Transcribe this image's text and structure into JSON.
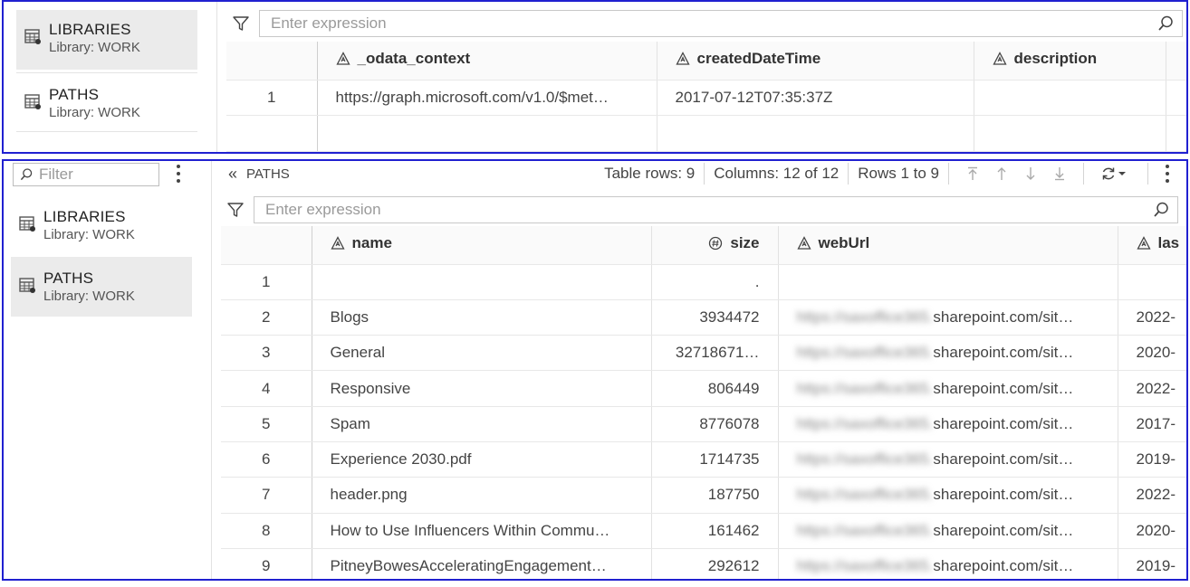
{
  "top_panel": {
    "libraries": [
      {
        "name": "LIBRARIES",
        "sub": "Library: WORK"
      },
      {
        "name": "PATHS",
        "sub": "Library: WORK"
      }
    ],
    "expression_placeholder": "Enter expression",
    "columns": [
      "_odata_context",
      "createdDateTime",
      "description"
    ],
    "rows": [
      {
        "num": "1",
        "odata_context": "https://graph.microsoft.com/v1.0/$met…",
        "createdDateTime": "2017-07-12T07:35:37Z",
        "description": ""
      }
    ]
  },
  "bottom_panel": {
    "side_filter_placeholder": "Filter",
    "libraries": [
      {
        "name": "LIBRARIES",
        "sub": "Library: WORK"
      },
      {
        "name": "PATHS",
        "sub": "Library: WORK"
      }
    ],
    "toolbar": {
      "collapse_glyph": "«",
      "table_name": "PATHS",
      "table_rows": "Table rows: 9",
      "columns": "Columns: 12 of 12",
      "rows_range": "Rows 1 to 9"
    },
    "expression_placeholder": "Enter expression",
    "columns": [
      "name",
      "size",
      "webUrl",
      "las"
    ],
    "rows": [
      {
        "num": "1",
        "name": "",
        "size": ".",
        "url_blur": "",
        "url": "",
        "last": ""
      },
      {
        "num": "2",
        "name": "Blogs",
        "size": "3934472",
        "url_blur": "https://saxoffice365.",
        "url": "sharepoint.com/sit…",
        "last": "2022-"
      },
      {
        "num": "3",
        "name": "General",
        "size": "32718671…",
        "url_blur": "https://saxoffice365.",
        "url": "sharepoint.com/sit…",
        "last": "2020-"
      },
      {
        "num": "4",
        "name": "Responsive",
        "size": "806449",
        "url_blur": "https://saxoffice365.",
        "url": "sharepoint.com/sit…",
        "last": "2022-"
      },
      {
        "num": "5",
        "name": "Spam",
        "size": "8776078",
        "url_blur": "https://saxoffice365.",
        "url": "sharepoint.com/sit…",
        "last": "2017-"
      },
      {
        "num": "6",
        "name": "Experience 2030.pdf",
        "size": "1714735",
        "url_blur": "https://saxoffice365.",
        "url": "sharepoint.com/sit…",
        "last": "2019-"
      },
      {
        "num": "7",
        "name": "header.png",
        "size": "187750",
        "url_blur": "https://saxoffice365.",
        "url": "sharepoint.com/sit…",
        "last": "2022-"
      },
      {
        "num": "8",
        "name": "How to Use Influencers Within Commu…",
        "size": "161462",
        "url_blur": "https://saxoffice365.",
        "url": "sharepoint.com/sit…",
        "last": "2020-"
      },
      {
        "num": "9",
        "name": "PitneyBowesAcceleratingEngagement…",
        "size": "292612",
        "url_blur": "https://saxoffice365.",
        "url": "sharepoint.com/sit…",
        "last": "2019-"
      }
    ]
  },
  "colors": {
    "panel_border": "#2020d0",
    "selected_bg": "#ebebeb"
  }
}
